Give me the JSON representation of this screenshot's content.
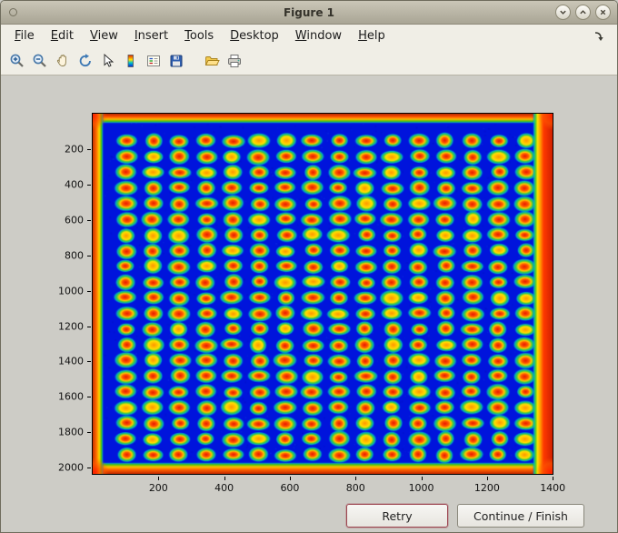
{
  "window": {
    "title": "Figure 1",
    "controls": [
      "minimize",
      "maximize",
      "close"
    ]
  },
  "menubar": {
    "items": [
      {
        "label": "File"
      },
      {
        "label": "Edit"
      },
      {
        "label": "View"
      },
      {
        "label": "Insert"
      },
      {
        "label": "Tools"
      },
      {
        "label": "Desktop"
      },
      {
        "label": "Window"
      },
      {
        "label": "Help"
      }
    ]
  },
  "toolbar": {
    "icons": [
      "zoom-in",
      "zoom-out",
      "pan",
      "rotate-3d",
      "data-cursor",
      "insert-colorbar",
      "insert-legend",
      "save",
      "open",
      "print"
    ]
  },
  "buttons": {
    "retry": "Retry",
    "continue": "Continue / Finish"
  },
  "chart_data": {
    "type": "heatmap",
    "title": "",
    "description": "Pseudocolor (jet colormap) scanned image of a spot array / plate: deep blue background, regular grid of red-orange spots with yellow-green halos, warm red-orange saturation along all four image edges, thick red band on the right edge",
    "x_ticks": [
      200,
      400,
      600,
      800,
      1000,
      1200,
      1400
    ],
    "y_ticks": [
      200,
      400,
      600,
      800,
      1000,
      1200,
      1400,
      1600,
      1800,
      2000
    ],
    "x_range": [
      0,
      1405
    ],
    "y_range": [
      0,
      2045
    ],
    "grid": {
      "columns": 16,
      "rows": 21
    },
    "spots": {
      "x_start": 102,
      "x_end": 1322,
      "y_start": 154,
      "y_end": 1937
    },
    "colors": {
      "background": "#0014dc",
      "spot_core": "#e81800",
      "spot_mid": "#ff9500",
      "spot_halo": "#3ecc3e",
      "edge_red": "#d02000",
      "edge_orange": "#ff9c00",
      "edge_green": "#50c800"
    },
    "legend": "none",
    "grid_lines": false
  }
}
